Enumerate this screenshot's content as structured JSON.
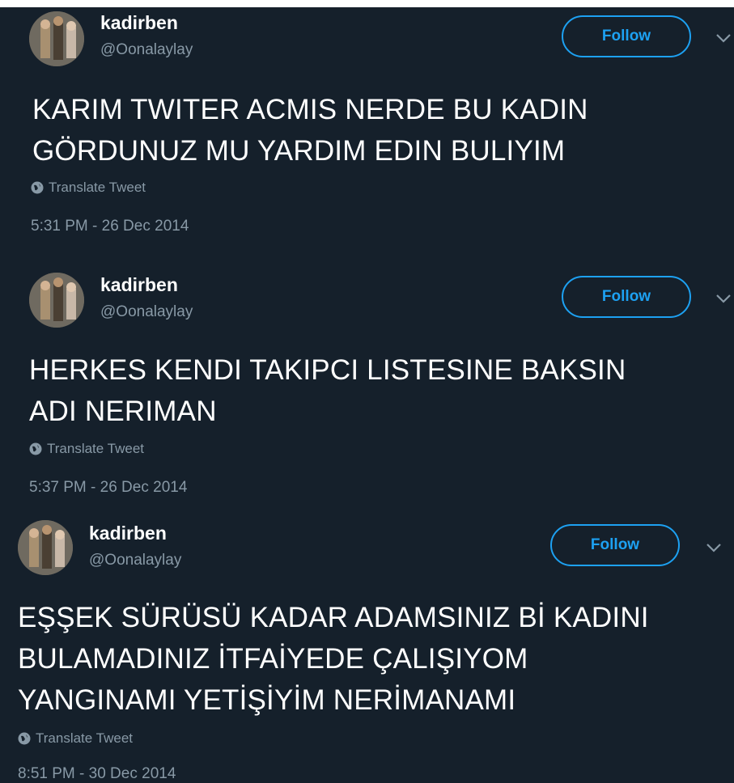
{
  "tweets": [
    {
      "name": "kadirben",
      "handle": "@Oonalaylay",
      "follow_label": "Follow",
      "lines": [
        "KARIM TWITER ACMIS NERDE BU KADIN",
        "GÖRDUNUZ MU YARDIM EDIN BULIYIM"
      ],
      "translate_label": "Translate Tweet",
      "timestamp": "5:31 PM - 26 Dec 2014"
    },
    {
      "name": "kadirben",
      "handle": "@Oonalaylay",
      "follow_label": "Follow",
      "lines": [
        "HERKES KENDI TAKIPCI LISTESINE BAKSIN",
        "ADI NERIMAN"
      ],
      "translate_label": "Translate Tweet",
      "timestamp": "5:37 PM - 26 Dec 2014"
    },
    {
      "name": "kadirben",
      "handle": "@Oonalaylay",
      "follow_label": "Follow",
      "lines": [
        "EŞŞEK SÜRÜSÜ KADAR ADAMSINIZ Bİ KADINI",
        "BULAMADINIZ İTFAİYEDE ÇALIŞIYOM",
        "YANGINAMI YETİŞİYİM NERİMANAMI"
      ],
      "translate_label": "Translate Tweet",
      "timestamp": "8:51 PM - 30 Dec 2014"
    }
  ],
  "colors": {
    "background": "#15202b",
    "accent": "#1da1f2",
    "secondary_text": "#8899a6"
  }
}
